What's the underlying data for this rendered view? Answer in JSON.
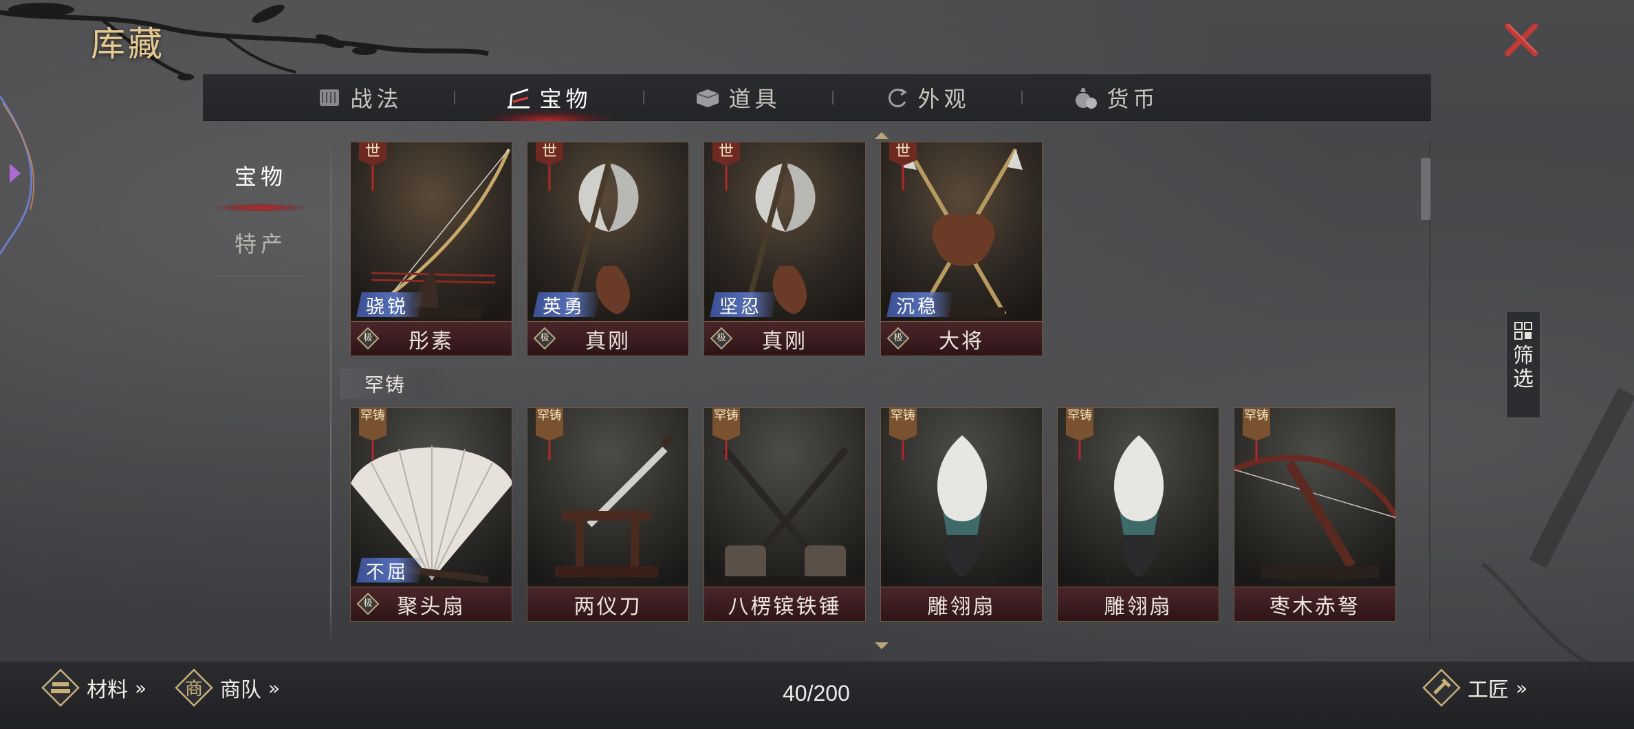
{
  "title": "库藏",
  "tabs": [
    {
      "label": "战法",
      "icon": "scroll-icon",
      "active": false
    },
    {
      "label": "宝物",
      "icon": "weapon-rack-icon",
      "active": true
    },
    {
      "label": "道具",
      "icon": "chest-icon",
      "active": false
    },
    {
      "label": "外观",
      "icon": "swirl-icon",
      "active": false
    },
    {
      "label": "货币",
      "icon": "money-bag-icon",
      "active": false
    }
  ],
  "subnav": [
    {
      "label": "宝物",
      "active": true
    },
    {
      "label": "特产",
      "active": false
    }
  ],
  "rarity_labels": {
    "top": "世",
    "rare": "罕铸"
  },
  "grade_label": "极",
  "section_rare": "罕铸",
  "cards_top": [
    {
      "name": "彤素",
      "trait": "骁锐",
      "art": "bow"
    },
    {
      "name": "真刚",
      "trait": "英勇",
      "art": "axe"
    },
    {
      "name": "真刚",
      "trait": "坚忍",
      "art": "axe"
    },
    {
      "name": "大将",
      "trait": "沉稳",
      "art": "spears"
    }
  ],
  "cards_rare": [
    {
      "name": "聚头扇",
      "trait": "不屈",
      "art": "fan",
      "grade": true
    },
    {
      "name": "两仪刀",
      "trait": "",
      "art": "sword",
      "grade": false
    },
    {
      "name": "八楞镔铁锤",
      "trait": "",
      "art": "hammers",
      "grade": false
    },
    {
      "name": "雕翎扇",
      "trait": "",
      "art": "feather",
      "grade": false
    },
    {
      "name": "雕翎扇",
      "trait": "",
      "art": "feather",
      "grade": false
    },
    {
      "name": "枣木赤弩",
      "trait": "",
      "art": "crossbow",
      "grade": false
    }
  ],
  "filter_label": "筛选",
  "bottom": {
    "materials": "材料",
    "caravan": "商队",
    "caravan_glyph": "商",
    "craftsman": "工匠",
    "chevron": "»",
    "count": "40/200"
  },
  "colors": {
    "accent_red": "#c8282a",
    "gold": "#e6c98f",
    "trait_blue": "#4a62a8"
  }
}
